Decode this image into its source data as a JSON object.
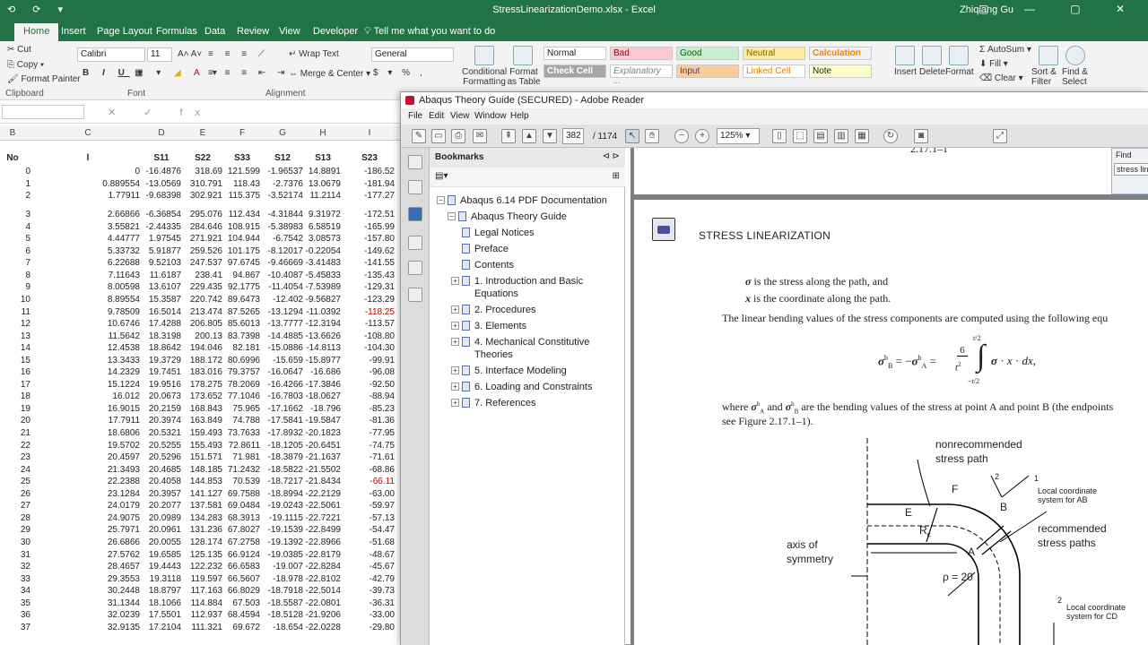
{
  "excel": {
    "window_title": "StressLinearizationDemo.xlsx  -  Excel",
    "user": "Zhiqiang Gu",
    "tabs": [
      "Home",
      "Insert",
      "Page Layout",
      "Formulas",
      "Data",
      "Review",
      "View",
      "Developer"
    ],
    "tell_me": "Tell me what you want to do",
    "ribbon": {
      "cut": "Cut",
      "copy": "Copy",
      "format_painter": "Format Painter",
      "clipboard": "Clipboard",
      "font_name": "Calibri",
      "font_size": "11",
      "font_group": "Font",
      "wrap_text": "Wrap Text",
      "merge_center": "Merge & Center",
      "alignment": "Alignment",
      "number_format": "General",
      "conditional_formatting": "Conditional Formatting",
      "format_as_table": "Format as Table",
      "styles": [
        "Normal",
        "Bad",
        "Good",
        "Neutral",
        "Calculation",
        "Check Cell",
        "Explanatory ...",
        "Input",
        "Linked Cell",
        "Note"
      ],
      "insert": "Insert",
      "delete": "Delete",
      "format": "Format",
      "autosum": "AutoSum",
      "fill": "Fill",
      "clear": "Clear",
      "sort_filter": "Sort & Filter",
      "find_select": "Find & Select"
    },
    "formula_bar": {
      "fx": "fx"
    },
    "column_letters": [
      "B",
      "C",
      "D",
      "E",
      "F",
      "G",
      "H",
      "I"
    ],
    "header": [
      "No",
      "l",
      "S11",
      "S22",
      "S33",
      "S12",
      "S13",
      "S23"
    ],
    "rows": [
      [
        "0",
        "0",
        "-16.4876",
        "318.69",
        "121.599",
        "-1.96537",
        "14.8891",
        "-186.52"
      ],
      [
        "1",
        "0.889554",
        "-13.0569",
        "310.791",
        "118.43",
        "-2.7376",
        "13.0679",
        "-181.94"
      ],
      [
        "2",
        "1.77911",
        "-9.68398",
        "302.921",
        "115.375",
        "-3.52174",
        "11.2114",
        "-177.27"
      ],
      [
        "3",
        "2.66866",
        "-6.36854",
        "295.076",
        "112.434",
        "-4.31844",
        "9.31972",
        "-172.51"
      ],
      [
        "4",
        "3.55821",
        "-2.44335",
        "284.646",
        "108.915",
        "-5.38983",
        "6.58519",
        "-165.99"
      ],
      [
        "5",
        "4.44777",
        "1.97545",
        "271.921",
        "104.944",
        "-6.7542",
        "3.08573",
        "-157.80"
      ],
      [
        "6",
        "5.33732",
        "5.91877",
        "259.526",
        "101.175",
        "-8.12017",
        "-0.22054",
        "-149.62"
      ],
      [
        "7",
        "6.22688",
        "9.52103",
        "247.537",
        "97.6745",
        "-9.46669",
        "-3.41483",
        "-141.55"
      ],
      [
        "8",
        "7.11643",
        "11.6187",
        "238.41",
        "94.867",
        "-10.4087",
        "-5.45833",
        "-135.43"
      ],
      [
        "9",
        "8.00598",
        "13.6107",
        "229.435",
        "92.1775",
        "-11.4054",
        "-7.53989",
        "-129.31"
      ],
      [
        "10",
        "8.89554",
        "15.3587",
        "220.742",
        "89.6473",
        "-12.402",
        "-9.56827",
        "-123.29"
      ],
      [
        "11",
        "9.78509",
        "16.5014",
        "213.474",
        "87.5265",
        "-13.1294",
        "-11.0392",
        "-118.25"
      ],
      [
        "12",
        "10.6746",
        "17.4288",
        "206.805",
        "85.6013",
        "-13.7777",
        "-12.3194",
        "-113.57"
      ],
      [
        "13",
        "11.5642",
        "18.3198",
        "200.13",
        "83.7398",
        "-14.4885",
        "-13.6626",
        "-108.80"
      ],
      [
        "14",
        "12.4538",
        "18.8642",
        "194.046",
        "82.181",
        "-15.0886",
        "-14.8113",
        "-104.30"
      ],
      [
        "15",
        "13.3433",
        "19.3729",
        "188.172",
        "80.6996",
        "-15.659",
        "-15.8977",
        "-99.91"
      ],
      [
        "16",
        "14.2329",
        "19.7451",
        "183.016",
        "79.3757",
        "-16.0647",
        "-16.686",
        "-96.08"
      ],
      [
        "17",
        "15.1224",
        "19.9516",
        "178.275",
        "78.2069",
        "-16.4266",
        "-17.3846",
        "-92.50"
      ],
      [
        "18",
        "16.012",
        "20.0673",
        "173.652",
        "77.1046",
        "-16.7803",
        "-18.0627",
        "-88.94"
      ],
      [
        "19",
        "16.9015",
        "20.2159",
        "168.843",
        "75.965",
        "-17.1662",
        "-18.796",
        "-85.23"
      ],
      [
        "20",
        "17.7911",
        "20.3974",
        "163.849",
        "74.788",
        "-17.5841",
        "-19.5847",
        "-81.36"
      ],
      [
        "21",
        "18.6806",
        "20.5321",
        "159.493",
        "73.7633",
        "-17.8932",
        "-20.1823",
        "-77.95"
      ],
      [
        "22",
        "19.5702",
        "20.5255",
        "155.493",
        "72.8611",
        "-18.1205",
        "-20.6451",
        "-74.75"
      ],
      [
        "23",
        "20.4597",
        "20.5296",
        "151.571",
        "71.981",
        "-18.3879",
        "-21.1637",
        "-71.61"
      ],
      [
        "24",
        "21.3493",
        "20.4685",
        "148.185",
        "71.2432",
        "-18.5822",
        "-21.5502",
        "-68.86"
      ],
      [
        "25",
        "22.2388",
        "20.4058",
        "144.853",
        "70.539",
        "-18.7217",
        "-21.8434",
        "-66.11"
      ],
      [
        "26",
        "23.1284",
        "20.3957",
        "141.127",
        "69.7588",
        "-18.8994",
        "-22.2129",
        "-63.00"
      ],
      [
        "27",
        "24.0179",
        "20.2077",
        "137.581",
        "69.0484",
        "-19.0243",
        "-22.5061",
        "-59.97"
      ],
      [
        "28",
        "24.9075",
        "20.0989",
        "134.283",
        "68.3913",
        "-19.1115",
        "-22.7221",
        "-57.13"
      ],
      [
        "29",
        "25.7971",
        "20.0961",
        "131.236",
        "67.8027",
        "-19.1539",
        "-22.8499",
        "-54.47"
      ],
      [
        "30",
        "26.6866",
        "20.0055",
        "128.174",
        "67.2758",
        "-19.1392",
        "-22.8966",
        "-51.68"
      ],
      [
        "31",
        "27.5762",
        "19.6585",
        "125.135",
        "66.9124",
        "-19.0385",
        "-22.8179",
        "-48.67"
      ],
      [
        "32",
        "28.4657",
        "19.4443",
        "122.232",
        "66.6583",
        "-19.007",
        "-22.8284",
        "-45.67"
      ],
      [
        "33",
        "29.3553",
        "19.3118",
        "119.597",
        "66.5607",
        "-18.978",
        "-22.8102",
        "-42.79"
      ],
      [
        "34",
        "30.2448",
        "18.8797",
        "117.163",
        "66.8029",
        "-18.7918",
        "-22.5014",
        "-39.73"
      ],
      [
        "35",
        "31.1344",
        "18.1066",
        "114.884",
        "67.503",
        "-18.5587",
        "-22.0801",
        "-36.31"
      ],
      [
        "36",
        "32.0239",
        "17.5501",
        "112.937",
        "68.4594",
        "-18.5128",
        "-21.9206",
        "-33.00"
      ],
      [
        "37",
        "32.9135",
        "17.2104",
        "111.321",
        "69.672",
        "-18.654",
        "-22.0228",
        "-29.80"
      ]
    ]
  },
  "reader": {
    "window_title": "Abaqus Theory Guide (SECURED) - Adobe Reader",
    "menu": [
      "File",
      "Edit",
      "View",
      "Window",
      "Help"
    ],
    "page_current": "382",
    "page_total": "/ 1174",
    "zoom": "125%",
    "bookmarks_title": "Bookmarks",
    "bookmarks": [
      {
        "label": "Abaqus 6.14 PDF Documentation",
        "level": 0,
        "exp": "−"
      },
      {
        "label": "Abaqus Theory Guide",
        "level": 1,
        "exp": "−"
      },
      {
        "label": "Legal Notices",
        "level": 2,
        "exp": ""
      },
      {
        "label": "Preface",
        "level": 2,
        "exp": ""
      },
      {
        "label": "Contents",
        "level": 2,
        "exp": ""
      },
      {
        "label": "1. Introduction and Basic Equations",
        "level": 2,
        "exp": "+"
      },
      {
        "label": "2. Procedures",
        "level": 2,
        "exp": "+"
      },
      {
        "label": "3. Elements",
        "level": 2,
        "exp": "+"
      },
      {
        "label": "4. Mechanical Constitutive Theories",
        "level": 2,
        "exp": "+"
      },
      {
        "label": "5. Interface Modeling",
        "level": 2,
        "exp": "+"
      },
      {
        "label": "6. Loading and Constraints",
        "level": 2,
        "exp": "+"
      },
      {
        "label": "7. References",
        "level": 2,
        "exp": "+"
      }
    ],
    "find": {
      "label": "Find",
      "value": "stress line"
    },
    "doc": {
      "prev_page_footer": "2.17.1–1",
      "heading": "STRESS LINEARIZATION",
      "line1": "is the stress along the path, and",
      "line2": "is the coordinate along the path.",
      "para": "The linear bending values of the stress components are computed using the following equ",
      "where_a": "where",
      "where_b": "and",
      "where_c": "are the bending values of the stress at point A and point B (the endpoints",
      "see_fig": "see Figure 2.17.1–1).",
      "fig": {
        "nonrecommended": "nonrecommended",
        "stress_path": "stress path",
        "F": "F",
        "E": "E",
        "B": "B",
        "A": "A",
        "Rc": "R",
        "n1": "1",
        "n2": "2",
        "n2b": "2",
        "local_ab_1": "Local coordinate",
        "local_ab_2": "system for AB",
        "recommended": "recommended",
        "stress_paths": "stress paths",
        "axis_of": "axis of",
        "symmetry": "symmetry",
        "rho": "ρ = 20",
        "local_cd_1": "Local coordinate",
        "local_cd_2": "system for CD"
      }
    }
  }
}
